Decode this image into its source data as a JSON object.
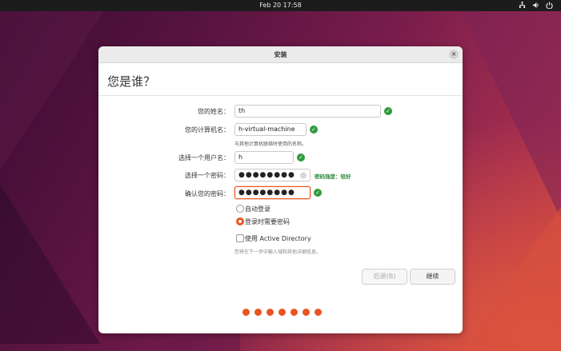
{
  "topbar": {
    "datetime": "Feb 20  17:58"
  },
  "window": {
    "title": "安装",
    "close": "×"
  },
  "page": {
    "heading": "您是谁？"
  },
  "form": {
    "name_label": "您的姓名：",
    "name_value": "th",
    "computer_label": "您的计算机名：",
    "computer_value": "h-virtual-machine",
    "computer_hint": "与其他计算机联络时使用的名称。",
    "username_label": "选择一个用户名：",
    "username_value": "h",
    "password_label": "选择一个密码：",
    "password_value": "●●●●●●●●",
    "password_strength": "密码强度：较好",
    "confirm_label": "确认您的密码：",
    "confirm_value": "●●●●●●●●",
    "check_mark": "✓"
  },
  "login": {
    "auto_login": "自动登录",
    "require_password": "登录时需要密码",
    "selected": "require_password"
  },
  "ad": {
    "label": "使用 Active Directory",
    "checked": false,
    "note": "您将在下一步中输入域和其他详细信息。"
  },
  "buttons": {
    "back": "后退(B)",
    "continue": "继续"
  },
  "progress": {
    "steps_shown": 7
  },
  "colors": {
    "accent": "#e95420",
    "success": "#2e9b3d"
  },
  "icons": {
    "network": "network-icon",
    "volume": "volume-icon",
    "power": "power-icon",
    "eye": "eye-icon"
  }
}
